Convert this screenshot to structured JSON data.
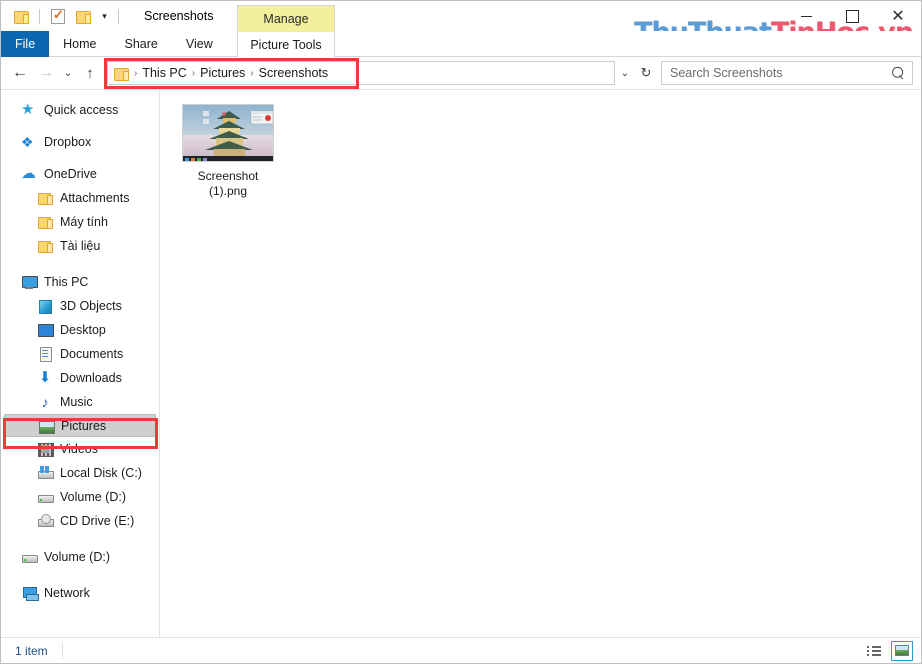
{
  "window": {
    "title": "Screenshots",
    "watermark_part1": "ThuThuat",
    "watermark_part2": "TinHoc.vn",
    "help_glyph": "?",
    "minimize_label": "",
    "maximize_label": "",
    "close_glyph": "✕"
  },
  "quick_access_toolbar": {
    "folder_label": "",
    "properties_label": "",
    "new_folder_label": "",
    "dropdown_glyph": "▾"
  },
  "ribbon": {
    "tabs": [
      {
        "label": "File"
      },
      {
        "label": "Home"
      },
      {
        "label": "Share"
      },
      {
        "label": "View"
      }
    ],
    "contextual": {
      "header": "Manage",
      "tab": "Picture Tools"
    }
  },
  "addressbar": {
    "back_glyph": "←",
    "forward_glyph": "→",
    "recent_glyph": "⌄",
    "up_glyph": "↑",
    "dropdown_glyph": "⌄",
    "refresh_glyph": "↻",
    "breadcrumb": [
      {
        "label": "This PC"
      },
      {
        "label": "Pictures"
      },
      {
        "label": "Screenshots"
      }
    ],
    "separator": "›"
  },
  "search": {
    "placeholder": "Search Screenshots",
    "value": ""
  },
  "sidebar": {
    "items": [
      {
        "label": "Quick access",
        "icon": "star-icon",
        "level": 0,
        "selected": false
      },
      {
        "label": "Dropbox",
        "icon": "dropbox-icon",
        "level": 0,
        "selected": false
      },
      {
        "label": "OneDrive",
        "icon": "cloud-icon",
        "level": 0,
        "selected": false
      },
      {
        "label": "Attachments",
        "icon": "folder-icon",
        "level": 1,
        "selected": false
      },
      {
        "label": "Máy tính",
        "icon": "folder-icon",
        "level": 1,
        "selected": false
      },
      {
        "label": "Tài liệu",
        "icon": "folder-icon",
        "level": 1,
        "selected": false
      },
      {
        "label": "This PC",
        "icon": "computer-icon",
        "level": 0,
        "selected": false
      },
      {
        "label": "3D Objects",
        "icon": "3d-objects-icon",
        "level": 1,
        "selected": false
      },
      {
        "label": "Desktop",
        "icon": "desktop-icon",
        "level": 1,
        "selected": false
      },
      {
        "label": "Documents",
        "icon": "documents-icon",
        "level": 1,
        "selected": false
      },
      {
        "label": "Downloads",
        "icon": "downloads-icon",
        "level": 1,
        "selected": false
      },
      {
        "label": "Music",
        "icon": "music-icon",
        "level": 1,
        "selected": false
      },
      {
        "label": "Pictures",
        "icon": "pictures-icon",
        "level": 1,
        "selected": true
      },
      {
        "label": "Videos",
        "icon": "videos-icon",
        "level": 1,
        "selected": false
      },
      {
        "label": "Local Disk (C:)",
        "icon": "hard-drive-windows-icon",
        "level": 1,
        "selected": false
      },
      {
        "label": "Volume (D:)",
        "icon": "hard-drive-icon",
        "level": 1,
        "selected": false
      },
      {
        "label": "CD Drive (E:)",
        "icon": "cd-drive-icon",
        "level": 1,
        "selected": false
      },
      {
        "label": "Volume (D:)",
        "icon": "hard-drive-icon",
        "level": 0,
        "selected": false
      },
      {
        "label": "Network",
        "icon": "network-icon",
        "level": 0,
        "selected": false
      }
    ]
  },
  "content": {
    "files": [
      {
        "name": "Screenshot\n(1).png",
        "name_line1": "Screenshot",
        "name_line2": "(1).png",
        "type": "image"
      }
    ]
  },
  "statusbar": {
    "item_count": "1 item",
    "view_details_label": "",
    "view_large_icons_label": ""
  },
  "colors": {
    "file_tab": "#0b66b0",
    "contextual_header": "#f4ef9d",
    "annotation_red": "#f03a3a",
    "watermark_blue": "#5b9bd5",
    "watermark_red": "#f0576f",
    "selection_gray": "#cfcfcf"
  }
}
